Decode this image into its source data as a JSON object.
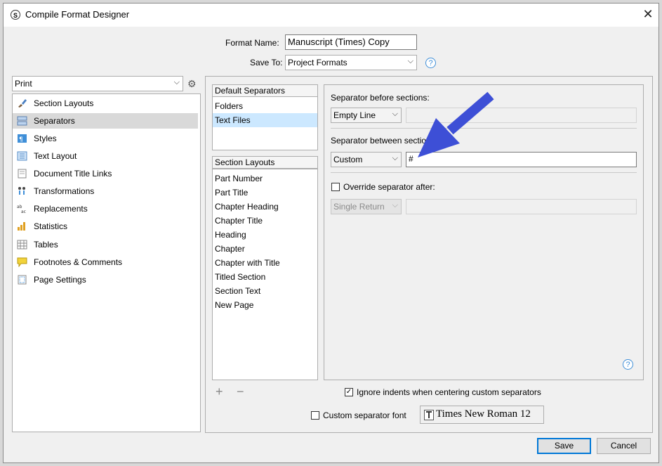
{
  "window": {
    "title": "Compile Format Designer"
  },
  "format": {
    "name_label": "Format Name:",
    "name_value": "Manuscript (Times) Copy",
    "save_to_label": "Save To:",
    "save_to_value": "Project Formats"
  },
  "format_type": {
    "value": "Print"
  },
  "sidebar": {
    "items": [
      {
        "label": "Section Layouts"
      },
      {
        "label": "Separators"
      },
      {
        "label": "Styles"
      },
      {
        "label": "Text Layout"
      },
      {
        "label": "Document Title Links"
      },
      {
        "label": "Transformations"
      },
      {
        "label": "Replacements"
      },
      {
        "label": "Statistics"
      },
      {
        "label": "Tables"
      },
      {
        "label": "Footnotes & Comments"
      },
      {
        "label": "Page Settings"
      }
    ]
  },
  "default_separators": {
    "header": "Default Separators",
    "items": [
      "Folders",
      "Text Files"
    ]
  },
  "section_layouts": {
    "header": "Section Layouts",
    "items": [
      "Part Number",
      "Part Title",
      "Chapter Heading",
      "Chapter Title",
      "Heading",
      "Chapter",
      "Chapter with Title",
      "Titled Section",
      "Section Text",
      "New Page"
    ]
  },
  "list_controls": {
    "add": "+",
    "remove": "−"
  },
  "separator_settings": {
    "before_label": "Separator before sections:",
    "before_value": "Empty Line",
    "between_label": "Separator between sections:",
    "between_value": "Custom",
    "between_text": "#",
    "override_label": "Override separator after:",
    "override_value": "Single Return"
  },
  "options": {
    "ignore_indents_label": "Ignore indents when centering custom separators",
    "ignore_indents_checked": "✓",
    "custom_font_label": "Custom separator font",
    "font_value": "Times New Roman 12"
  },
  "footer": {
    "save": "Save",
    "cancel": "Cancel"
  },
  "colors": {
    "accent": "#0078d7",
    "annotation_arrow": "#3d4fd6",
    "selection": "#cce8ff"
  }
}
